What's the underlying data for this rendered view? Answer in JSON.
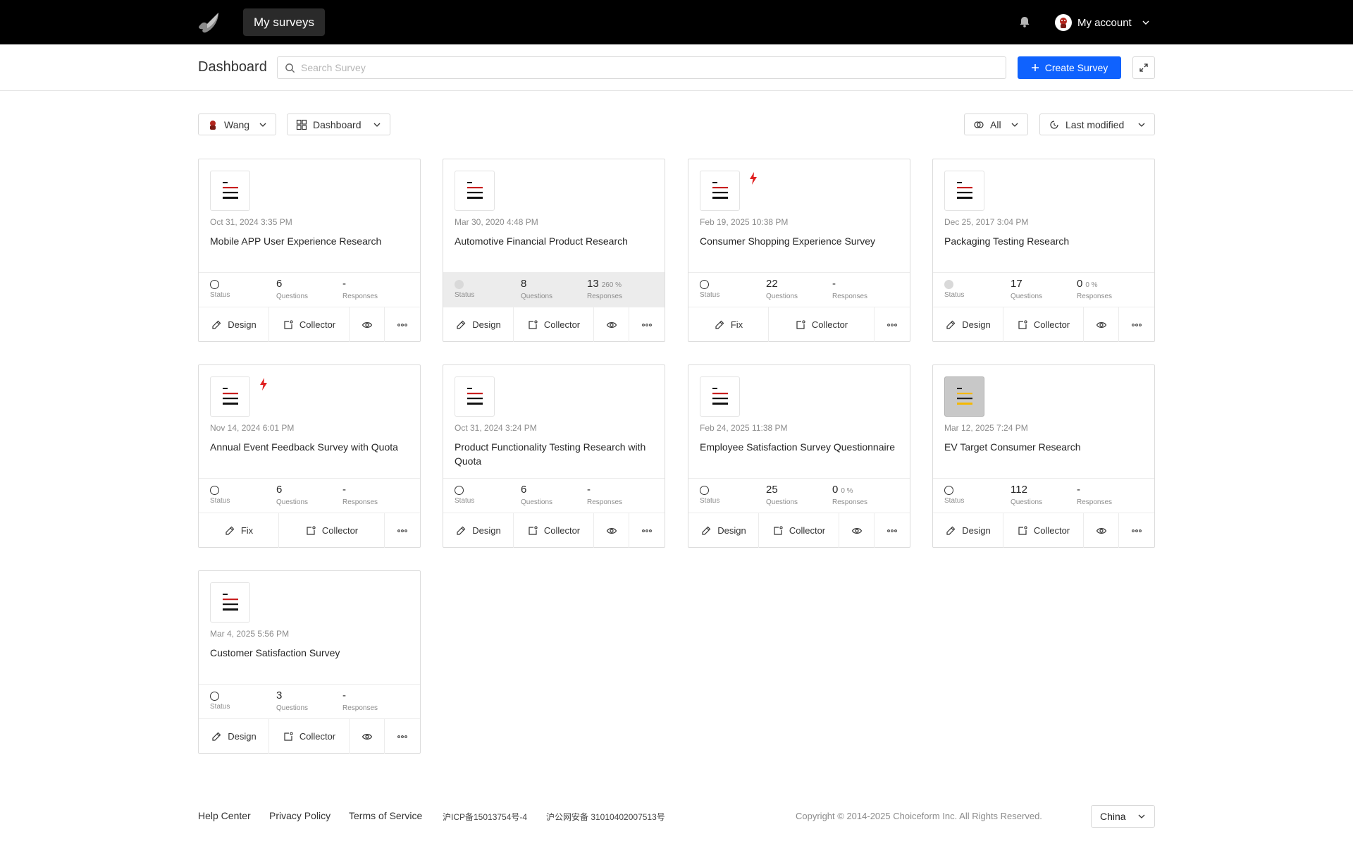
{
  "topbar": {
    "nav_tab": "My surveys",
    "account_label": "My account"
  },
  "header": {
    "title": "Dashboard",
    "search_placeholder": "Search Survey",
    "create_label": "Create Survey"
  },
  "filters": {
    "user": "Wang",
    "view": "Dashboard",
    "status": "All",
    "sort": "Last modified"
  },
  "labels": {
    "status": "Status",
    "questions": "Questions",
    "responses": "Responses"
  },
  "colors": {
    "accent": "#0f62fe",
    "bolt": "#e02020",
    "thumb_red": "#c81e1e",
    "thumb_yellow": "#f5b800"
  },
  "surveys": [
    {
      "date": "Oct 31, 2024 3:35 PM",
      "title": "Mobile APP User Experience Research",
      "status": "open",
      "questions": "6",
      "responses": "-",
      "percent": "",
      "bolt": false,
      "thumb": "red",
      "shaded": false,
      "actions": [
        "Design",
        "Collector",
        "preview",
        "more"
      ]
    },
    {
      "date": "Mar 30, 2020 4:48 PM",
      "title": "Automotive Financial Product Research",
      "status": "closed",
      "questions": "8",
      "responses": "13",
      "percent": "260 %",
      "bolt": false,
      "thumb": "red",
      "shaded": true,
      "actions": [
        "Design",
        "Collector",
        "preview",
        "more"
      ]
    },
    {
      "date": "Feb 19, 2025 10:38 PM",
      "title": "Consumer Shopping Experience Survey",
      "status": "open",
      "questions": "22",
      "responses": "-",
      "percent": "",
      "bolt": true,
      "thumb": "red",
      "shaded": false,
      "actions": [
        "Fix",
        "Collector",
        "more"
      ]
    },
    {
      "date": "Dec 25, 2017 3:04 PM",
      "title": "Packaging Testing Research",
      "status": "closed",
      "questions": "17",
      "responses": "0",
      "percent": "0 %",
      "bolt": false,
      "thumb": "red",
      "shaded": false,
      "actions": [
        "Design",
        "Collector",
        "preview",
        "more"
      ]
    },
    {
      "date": "Nov 14, 2024 6:01 PM",
      "title": "Annual Event Feedback Survey with Quota",
      "status": "open",
      "questions": "6",
      "responses": "-",
      "percent": "",
      "bolt": true,
      "thumb": "red",
      "shaded": false,
      "actions": [
        "Fix",
        "Collector",
        "more"
      ]
    },
    {
      "date": "Oct 31, 2024 3:24 PM",
      "title": "Product Functionality Testing Research with Quota",
      "status": "open",
      "questions": "6",
      "responses": "-",
      "percent": "",
      "bolt": false,
      "thumb": "red",
      "shaded": false,
      "actions": [
        "Design",
        "Collector",
        "preview",
        "more"
      ]
    },
    {
      "date": "Feb 24, 2025 11:38 PM",
      "title": "Employee Satisfaction Survey Questionnaire",
      "status": "open",
      "questions": "25",
      "responses": "0",
      "percent": "0 %",
      "bolt": false,
      "thumb": "red",
      "shaded": false,
      "actions": [
        "Design",
        "Collector",
        "preview",
        "more"
      ]
    },
    {
      "date": "Mar 12, 2025 7:24 PM",
      "title": "EV Target Consumer Research",
      "status": "open",
      "questions": "112",
      "responses": "-",
      "percent": "",
      "bolt": false,
      "thumb": "yellow",
      "shaded": false,
      "actions": [
        "Design",
        "Collector",
        "preview",
        "more"
      ]
    },
    {
      "date": "Mar 4, 2025 5:56 PM",
      "title": "Customer Satisfaction Survey",
      "status": "open",
      "questions": "3",
      "responses": "-",
      "percent": "",
      "bolt": false,
      "thumb": "red",
      "shaded": false,
      "actions": [
        "Design",
        "Collector",
        "preview",
        "more"
      ]
    }
  ],
  "footer": {
    "help": "Help Center",
    "privacy": "Privacy Policy",
    "terms": "Terms of Service",
    "icp": "沪ICP备15013754号-4",
    "police": "沪公网安备 31010402007513号",
    "copyright": "Copyright © 2014-2025 Choiceform Inc. All Rights Reserved.",
    "region": "China"
  }
}
